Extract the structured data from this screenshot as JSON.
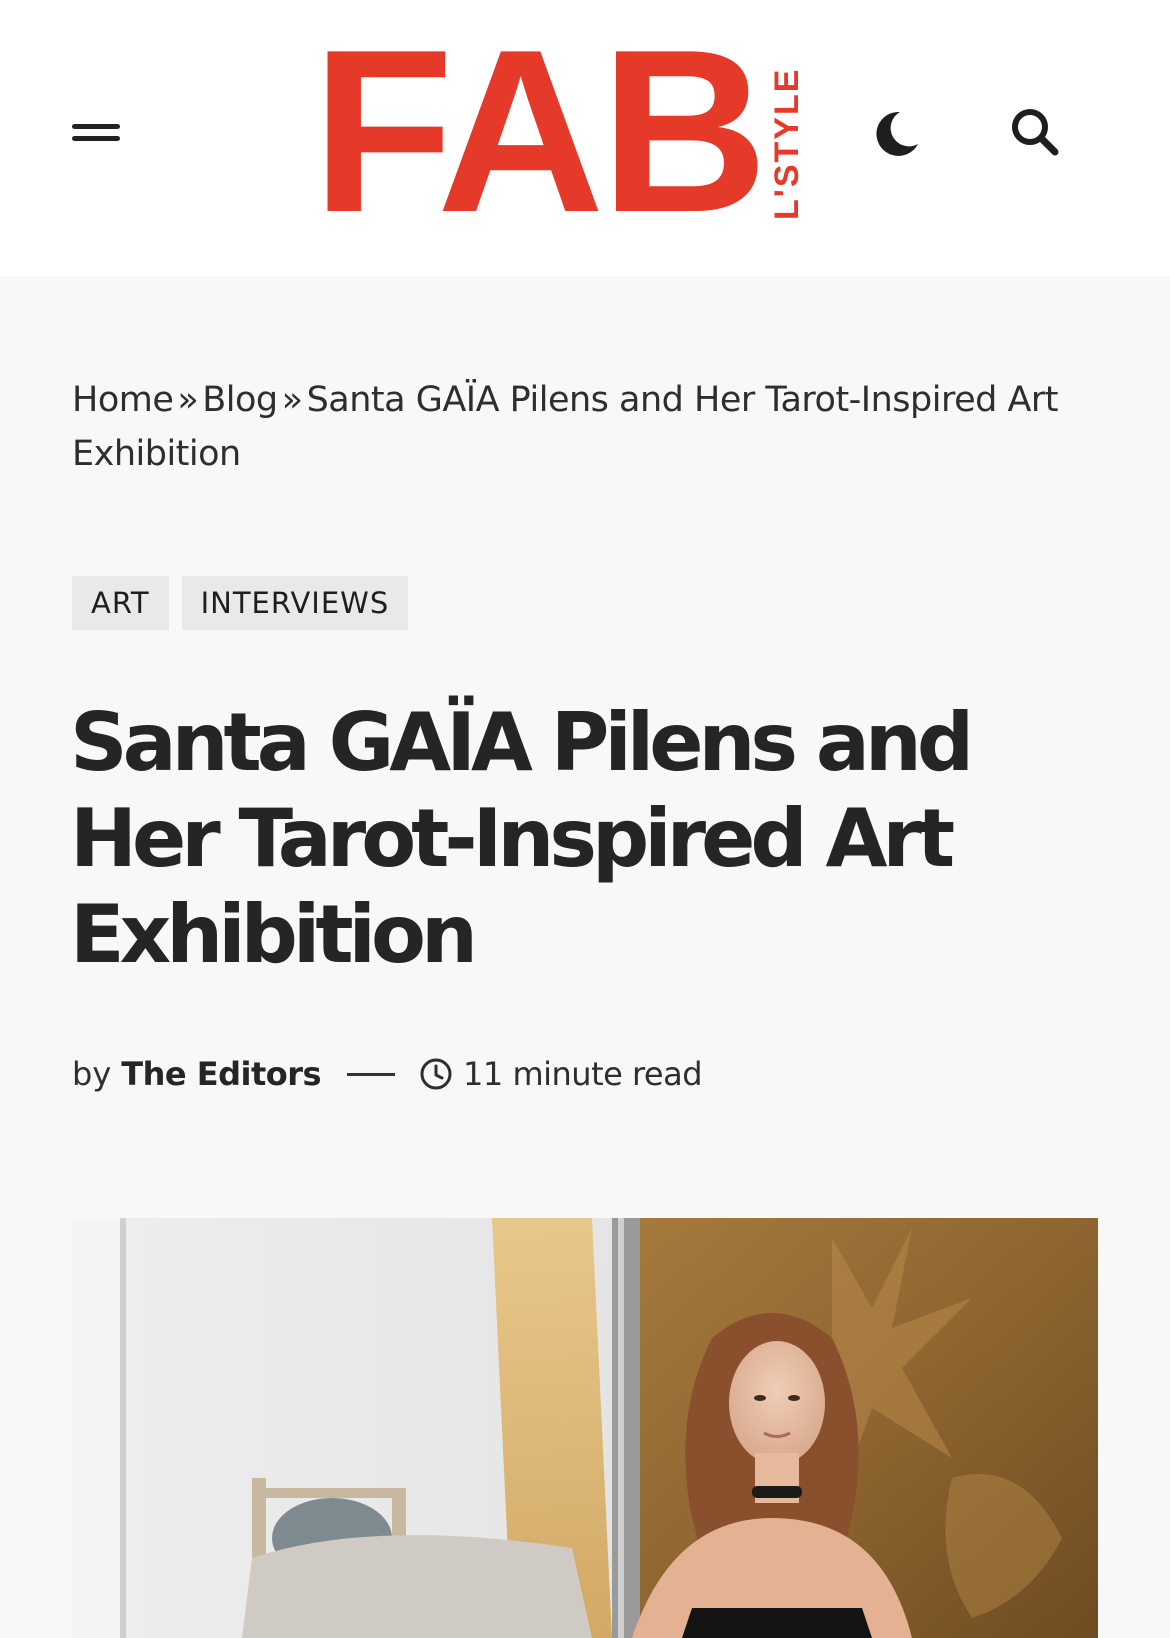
{
  "header": {
    "logo_main": "FAB",
    "logo_sub": "L'STYLE",
    "menu_icon": "hamburger-menu-icon",
    "theme_icon": "moon-icon",
    "search_icon": "search-icon",
    "brand_color": "#e5392a"
  },
  "breadcrumb": {
    "home": "Home",
    "blog": "Blog",
    "separator": "»",
    "current": "Santa GAÏA Pilens and Her Tarot-Inspired Art Exhibition"
  },
  "tags": [
    "ART",
    "INTERVIEWS"
  ],
  "article": {
    "title": "Santa GAÏA Pilens and Her Tarot-Inspired Art Exhibition",
    "byline_prefix": "by",
    "author": "The Editors",
    "read_time": "11 minute read",
    "clock_icon": "clock-icon"
  },
  "hero_image": {
    "subject": "portrait photograph"
  }
}
